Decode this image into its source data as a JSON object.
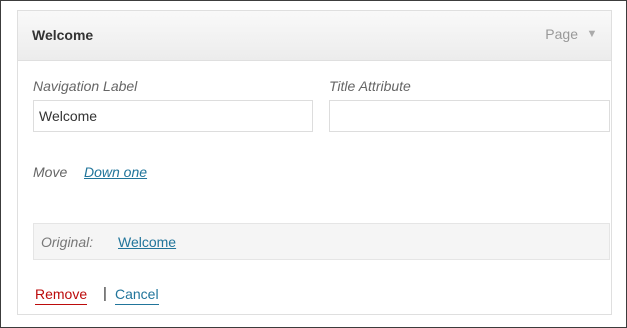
{
  "menu_item": {
    "title": "Welcome",
    "type": "Page",
    "toggle_icon": "triangle-down-icon"
  },
  "fields": {
    "navigation_label": {
      "label": "Navigation Label",
      "value": "Welcome"
    },
    "title_attribute": {
      "label": "Title Attribute",
      "value": ""
    }
  },
  "move": {
    "label": "Move",
    "link": "Down one"
  },
  "original": {
    "label": "Original:",
    "link": "Welcome"
  },
  "actions": {
    "remove": "Remove",
    "separator": "|",
    "cancel": "Cancel"
  },
  "colors": {
    "link": "#21759b",
    "remove": "#bc0b0b"
  }
}
